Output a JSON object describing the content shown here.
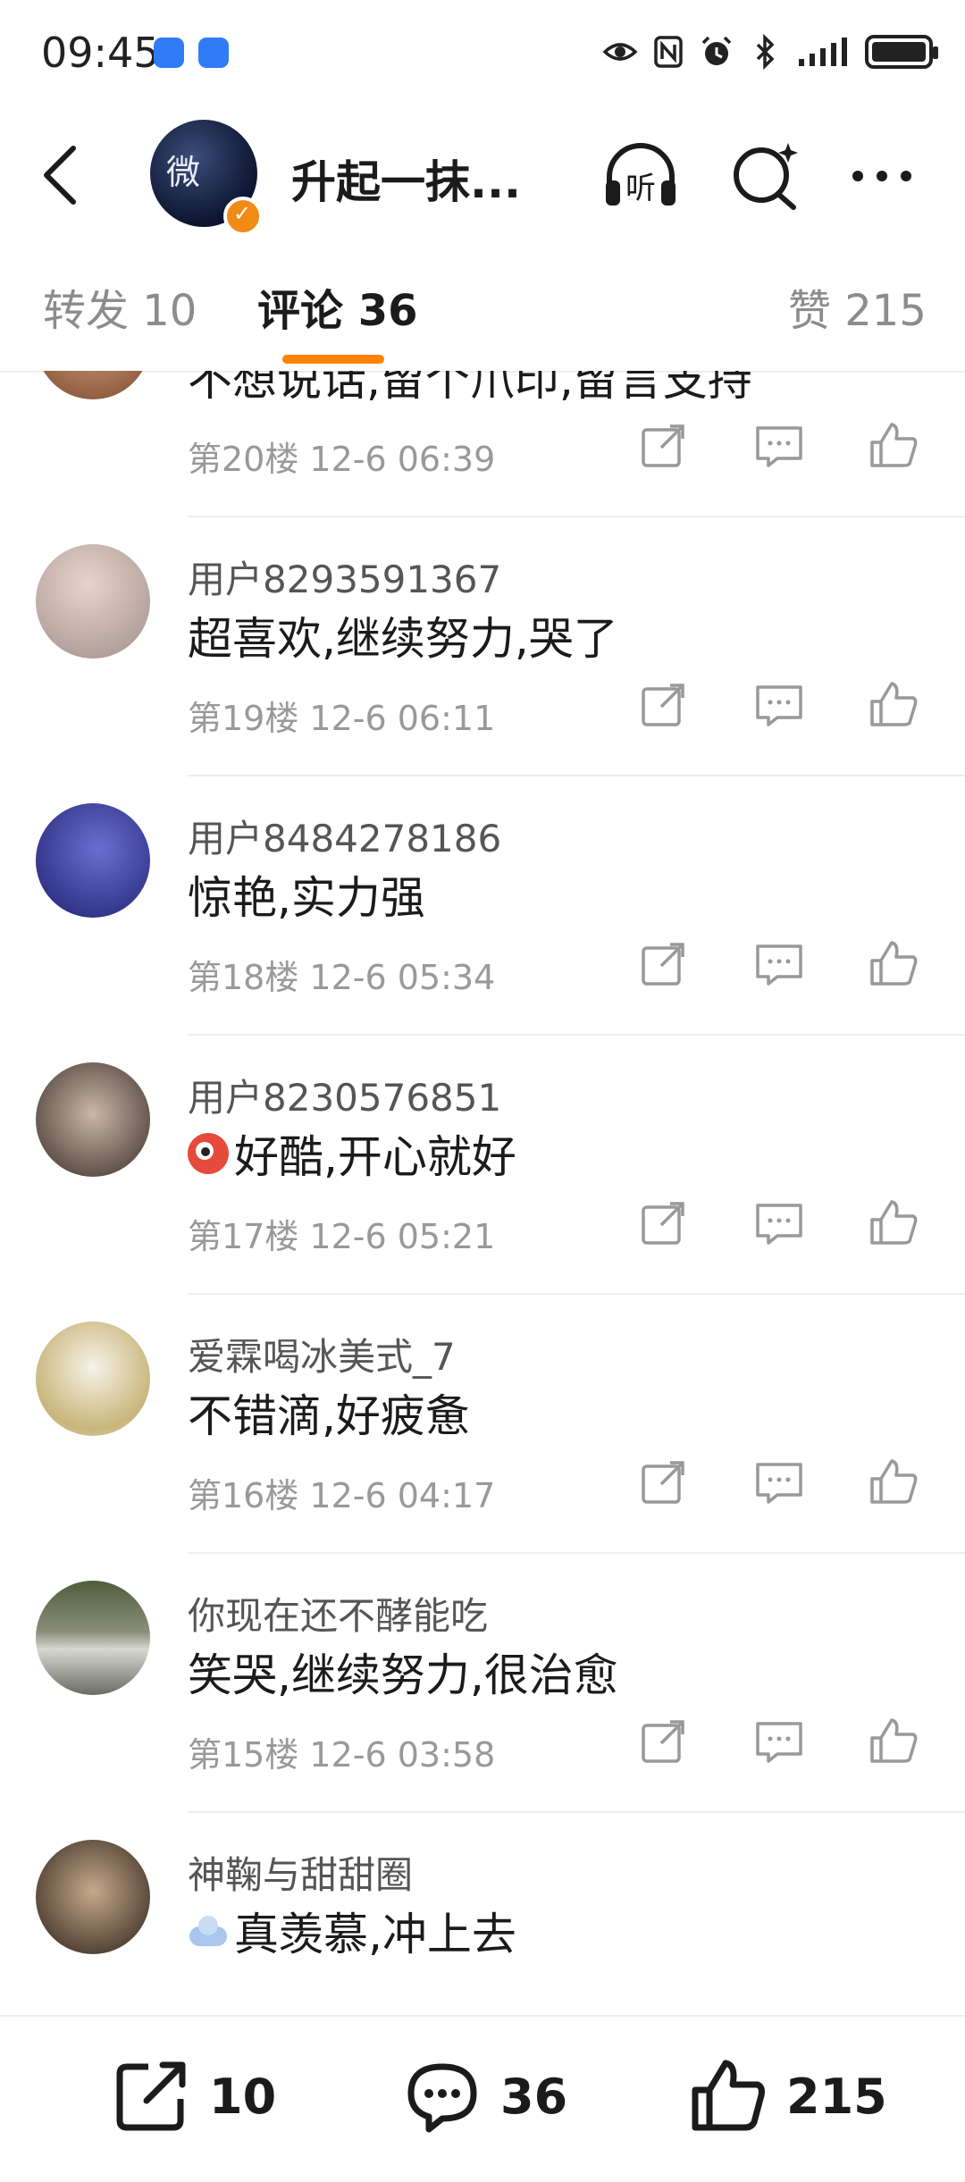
{
  "status_bar": {
    "time": "09:45",
    "app_icon_color": "#2f7cf6",
    "icons": [
      "eye-icon",
      "nfc-icon",
      "alarm-icon",
      "bluetooth-icon",
      "signal-icon",
      "battery-icon"
    ]
  },
  "header": {
    "title": "升起一抹...",
    "avatar_text": "微",
    "accent": "#ff8200",
    "verified_color": "#f28b16"
  },
  "tabs": {
    "repost": "转发 10",
    "comments": "评论 36",
    "likes": "赞 215"
  },
  "comments": [
    {
      "user": "",
      "text": "不想说话,留个爪印,留言支持",
      "meta": "第20楼  12-6 06:39",
      "emoji": ""
    },
    {
      "user": "用户8293591367",
      "text": "超喜欢,继续努力,哭了",
      "meta": "第19楼  12-6 06:11",
      "emoji": ""
    },
    {
      "user": "用户8484278186",
      "text": "惊艳,实力强",
      "meta": "第18楼  12-6 05:34",
      "emoji": ""
    },
    {
      "user": "用户8230576851",
      "text": "好酷,开心就好",
      "meta": "第17楼  12-6 05:21",
      "emoji": "red-face-emoji"
    },
    {
      "user": "爱霖喝冰美式_7",
      "text": "不错滴,好疲惫",
      "meta": "第16楼  12-6 04:17",
      "emoji": ""
    },
    {
      "user": "你现在还不酵能吃",
      "text": "笑哭,继续努力,很治愈",
      "meta": "第15楼  12-6 03:58",
      "emoji": ""
    },
    {
      "user": "神鞠与甜甜圈",
      "text": "真羡慕,冲上去",
      "meta": "",
      "emoji": "cloud-emoji"
    }
  ],
  "bottom_bar": {
    "repost_count": "10",
    "comment_count": "36",
    "like_count": "215"
  }
}
